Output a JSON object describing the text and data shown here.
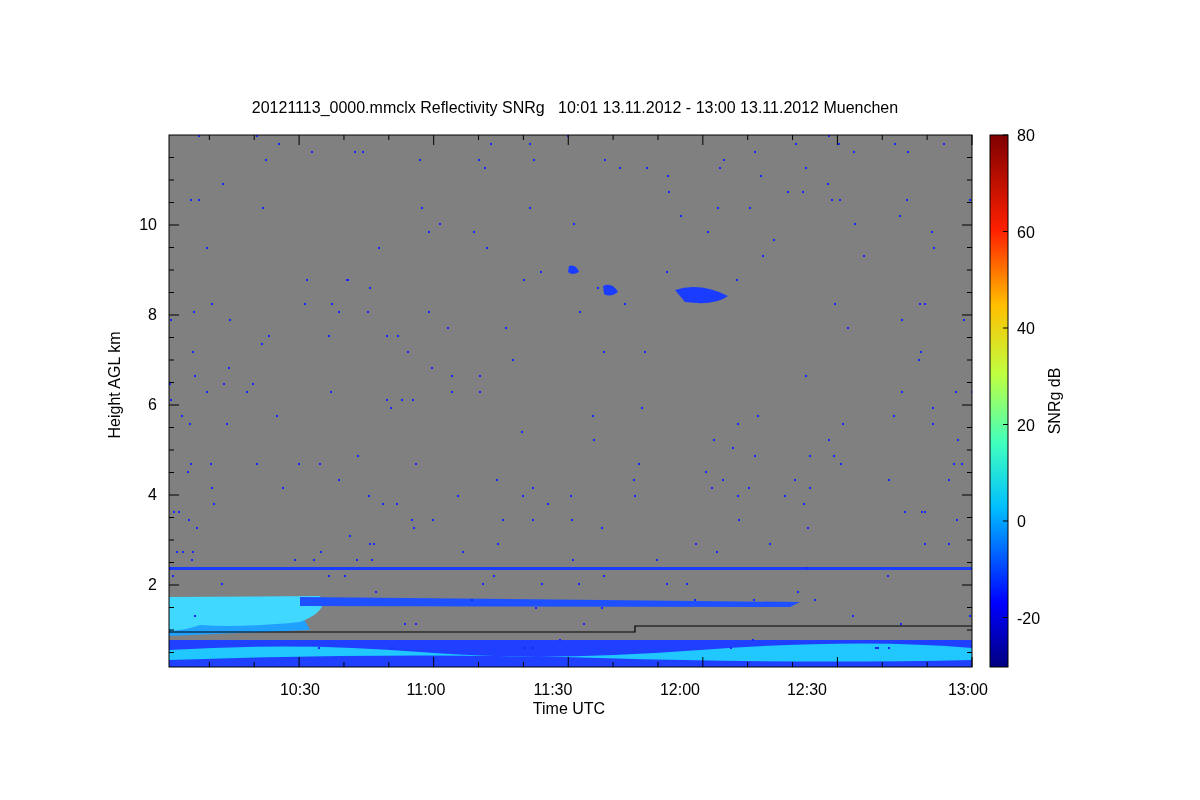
{
  "title": "20121113_0000.mmclx Reflectivity SNRg   10:01 13.11.2012 - 13:00 13.11.2012 Muenchen",
  "ylabel": "Height AGL km",
  "xlabel": "Time UTC",
  "yticks": [
    "10",
    "8",
    "6",
    "4",
    "2"
  ],
  "xticks": [
    "10:30",
    "11:00",
    "11:30",
    "12:00",
    "12:30",
    "13:00"
  ],
  "colorbar": {
    "label": "SNRg dB",
    "ticks": [
      "80",
      "60",
      "40",
      "20",
      "0",
      "-20"
    ]
  }
}
